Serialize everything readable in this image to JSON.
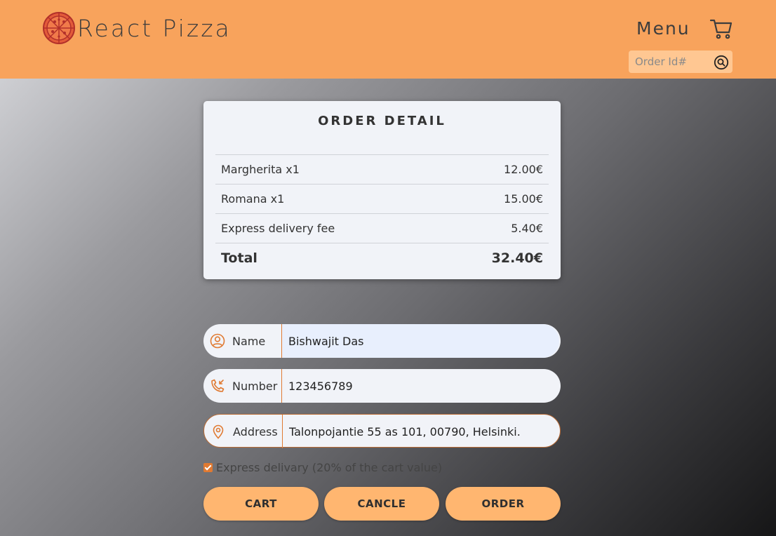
{
  "header": {
    "brand": "React Pizza",
    "menu_label": "Menu",
    "order_search": {
      "placeholder": "Order Id#",
      "value": ""
    },
    "colors": {
      "header_bg": "#f8a35c",
      "logo": "#c0392b"
    }
  },
  "order_detail": {
    "title": "ORDER DETAIL",
    "items": [
      {
        "name": "Margherita x1",
        "price": "12.00€"
      },
      {
        "name": "Romana x1",
        "price": "15.00€"
      },
      {
        "name": "Express delivery fee",
        "price": "5.40€"
      }
    ],
    "total_label": "Total",
    "total_value": "32.40€"
  },
  "form": {
    "name": {
      "label": "Name",
      "value": "Bishwajit Das",
      "icon": "user-icon"
    },
    "number": {
      "label": "Number",
      "value": "123456789",
      "icon": "phone-icon"
    },
    "address": {
      "label": "Address",
      "value": "Talonpojantie 55 as 101, 00790, Helsinki.",
      "icon": "location-icon"
    },
    "express_label": "Express delivary (20% of the cart value)",
    "express_checked": true
  },
  "buttons": {
    "cart": "CART",
    "cancel": "CANCLE",
    "order": "ORDER"
  },
  "accent_color": "#e07a32"
}
